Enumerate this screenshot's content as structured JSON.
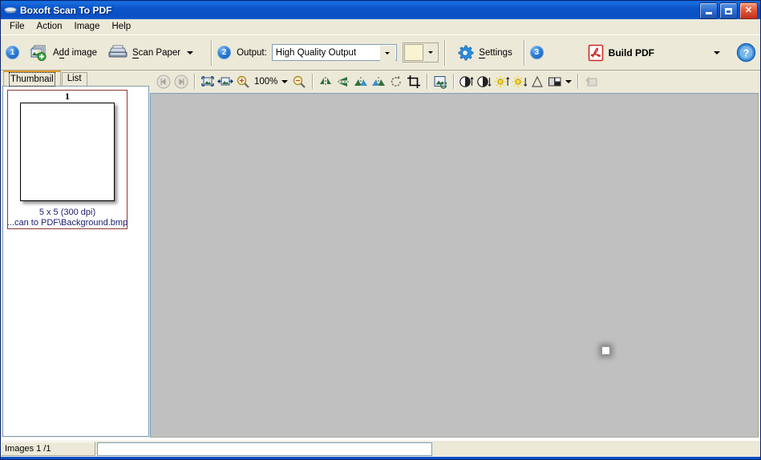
{
  "window": {
    "title": "Boxoft Scan To PDF",
    "icon": "scanner-icon",
    "minimize_label": "Minimize",
    "maximize_label": "Maximize",
    "close_label": "Close"
  },
  "menu": {
    "items": [
      {
        "label": "File"
      },
      {
        "label": "Action"
      },
      {
        "label": "Image"
      },
      {
        "label": "Help"
      }
    ]
  },
  "toolbar": {
    "step1_badge": "1",
    "add_image_label": "Add image",
    "scan_paper_label": "Scan Paper",
    "step2_badge": "2",
    "output_label": "Output:",
    "output_value": "High Quality Output",
    "output_options": [
      "High Quality Output"
    ],
    "color_swatch": "#faf3d2",
    "settings_label": "Settings",
    "step3_badge": "3",
    "build_pdf_label": "Build PDF",
    "help_label": "?"
  },
  "sidebar": {
    "tabs": [
      {
        "label": "Thumbnail",
        "active": true
      },
      {
        "label": "List",
        "active": false
      }
    ],
    "thumbnails": [
      {
        "number": "1",
        "size": "5 x 5 (300 dpi)",
        "path": "...can to PDF\\Background.bmp"
      }
    ]
  },
  "image_toolbar": {
    "first_label": "First image",
    "last_label": "Last image",
    "fit_image_label": "Fit image",
    "fit_width_label": "Fit width",
    "zoom_in_label": "Zoom in",
    "zoom_value": "100%",
    "zoom_out_label": "Zoom out",
    "flip_horizontal_label": "Flip horizontal",
    "flip_vertical_label": "Flip vertical",
    "rotate_left_label": "Rotate left",
    "rotate_right_label": "Rotate right",
    "rotate_label": "Rotate",
    "crop_label": "Crop",
    "deskew_label": "Deskew",
    "contrast_up_label": "Increase contrast",
    "contrast_down_label": "Decrease contrast",
    "brightness_up_label": "Increase brightness",
    "brightness_down_label": "Decrease brightness",
    "gamma_label": "Gamma",
    "color_mode_label": "Color mode",
    "undo_label": "Undo"
  },
  "status": {
    "images_count": "Images 1 /1",
    "progress_text": ""
  }
}
